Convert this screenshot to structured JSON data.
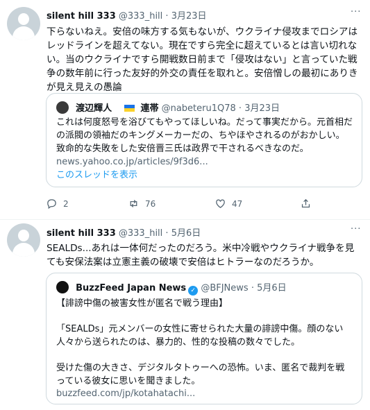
{
  "tweets": [
    {
      "name": "silent hill 333",
      "handle": "@333_hill",
      "dot": "·",
      "date": "3月23日",
      "text": "下らないねえ。安倍の味方する気もないが、ウクライナ侵攻までロシアはレッドラインを超えてない。現在ですら完全に超えているとは言い切れない。当のウクライナですら開戦数日前まで「侵攻はない」と言っていた戦争の数年前に行った友好的外交の責任を取れと。安倍憎しの最初にありきが見え見えの愚論",
      "quote": {
        "name": "渡辺輝人",
        "name_suffix": "連帯",
        "handle": "@nabeteru1Q78",
        "dot": "·",
        "date": "3月23日",
        "text": "これは何度怒号を浴びてもやってほしいね。だって事実だから。元首相だの派閥の領袖だのキングメーカーだの、ちやほやされるのがおかしい。致命的な失敗をした安倍晋三氏は政界で干されるべきなのだ。",
        "link": "news.yahoo.co.jp/articles/9f3d6...",
        "thread": "このスレッドを表示"
      },
      "actions": {
        "reply": "2",
        "retweet": "76",
        "like": "47"
      }
    },
    {
      "name": "silent hill 333",
      "handle": "@333_hill",
      "dot": "·",
      "date": "5月6日",
      "text": "SEALDs...あれは一体何だったのだろう。米中冷戦やウクライナ戦争を見ても安保法案は立憲主義の破壊で安倍はヒトラーなのだろうか。",
      "quote": {
        "name": "BuzzFeed Japan News",
        "handle": "@BFJNews",
        "dot": "·",
        "date": "5月6日",
        "p1": "【誹謗中傷の被害女性が匿名で戦う理由】",
        "p2": "「SEALDs」元メンバーの女性に寄せられた大量の誹謗中傷。顔のない人々から送られたのは、暴力的、性的な投稿の数々でした。",
        "p3": "受けた傷の大きさ、デジタルタトゥーへの恐怖。いま、匿名で裁判を戦っている彼女に思いを聞きました。",
        "link": "buzzfeed.com/jp/kotahatachi..."
      }
    }
  ],
  "more_label": "···",
  "verified_mark": "✓",
  "colors": {
    "link": "#1d9bf0",
    "muted": "#536471",
    "border": "#cfd9de"
  }
}
